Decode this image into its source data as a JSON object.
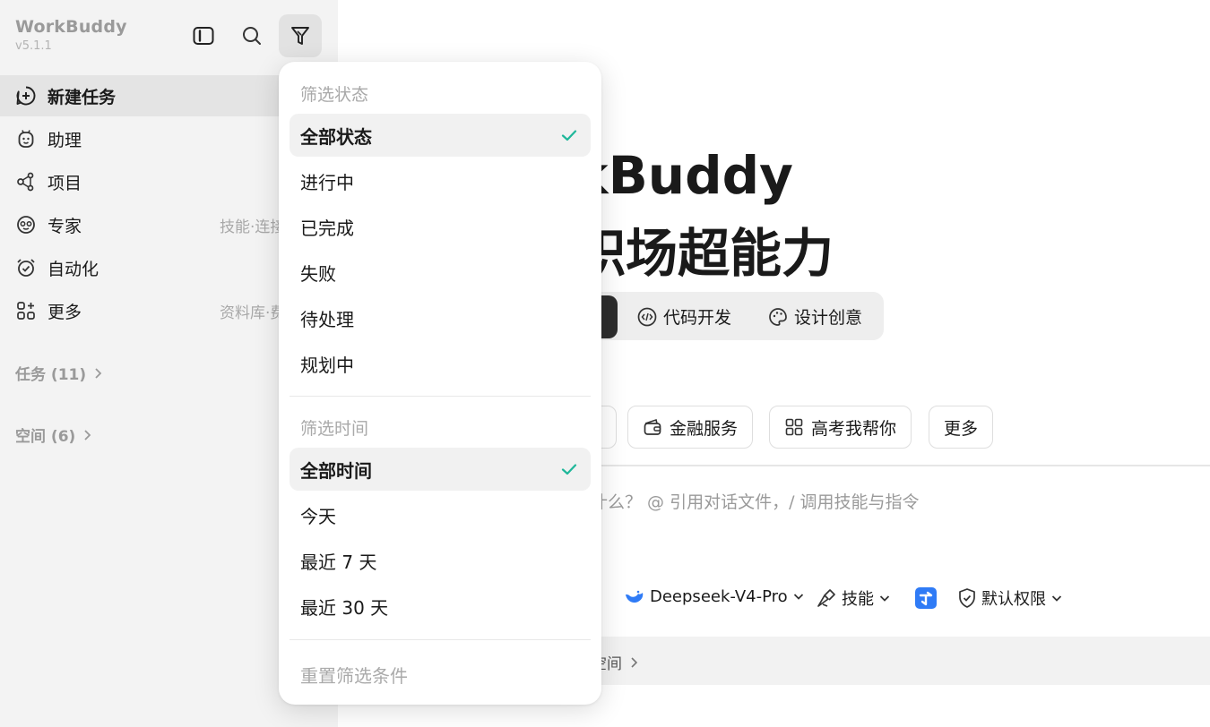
{
  "app": {
    "name": "WorkBuddy",
    "version": "v5.1.1"
  },
  "sidebar": {
    "nav": [
      {
        "label": "新建任务",
        "sub": ""
      },
      {
        "label": "助理",
        "sub": ""
      },
      {
        "label": "项目",
        "sub": ""
      },
      {
        "label": "专家",
        "sub": "技能·连接"
      },
      {
        "label": "自动化",
        "sub": ""
      },
      {
        "label": "更多",
        "sub": "资料库·费"
      }
    ],
    "tasks_label": "任务 (11)",
    "spaces_label": "空间 (6)"
  },
  "main": {
    "hero_line1": "kBuddy",
    "hero_line2": "职场超能力",
    "tabs": [
      "代码开发",
      "设计创意"
    ],
    "chips": [
      "金融服务",
      "高考我帮你",
      "更多"
    ],
    "input_placeholder": "些什么？ @ 引用对话文件，/ 调用技能与指令",
    "toolbar": {
      "model": "Deepseek-V4-Pro",
      "skills": "技能",
      "permission": "默认权限"
    },
    "workspace_label": "空间"
  },
  "filter_dropdown": {
    "status_heading": "筛选状态",
    "status_options": [
      "全部状态",
      "进行中",
      "已完成",
      "失败",
      "待处理",
      "规划中"
    ],
    "status_selected": "全部状态",
    "time_heading": "筛选时间",
    "time_options": [
      "全部时间",
      "今天",
      "最近 7 天",
      "最近 30 天"
    ],
    "time_selected": "全部时间",
    "reset_label": "重置筛选条件"
  },
  "colors": {
    "check": "#1fb79a",
    "accent_blue": "#2f7bf6"
  }
}
